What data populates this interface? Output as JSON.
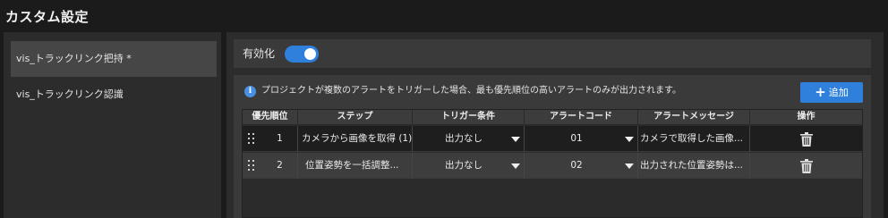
{
  "header": {
    "title": "カスタム設定"
  },
  "sidebar": {
    "items": [
      {
        "label": "vis_トラックリンク把持 *",
        "active": true
      },
      {
        "label": "vis_トラックリンク認識",
        "active": false
      }
    ]
  },
  "toggle": {
    "label": "有効化",
    "enabled": true
  },
  "info": {
    "icon": "info-icon",
    "text": "プロジェクトが複数のアラートをトリガーした場合、最も優先順位の高いアラートのみが出力されます。"
  },
  "add_button": {
    "icon": "plus-icon",
    "label": "追加"
  },
  "table": {
    "columns": [
      "優先順位",
      "ステップ",
      "トリガー条件",
      "アラートコード",
      "アラートメッセージ",
      "操作"
    ],
    "rows": [
      {
        "priority": "1",
        "step": "カメラから画像を取得 (1)",
        "trigger": "出力なし",
        "code": "01",
        "message": "カメラで取得した画像..."
      },
      {
        "priority": "2",
        "step": "位置姿勢を一括調整...",
        "trigger": "出力なし",
        "code": "02",
        "message": "出力された位置姿勢は..."
      }
    ]
  },
  "colors": {
    "accent": "#2f80dc",
    "background": "#1b1b1b",
    "panel": "#2c2c2c"
  }
}
